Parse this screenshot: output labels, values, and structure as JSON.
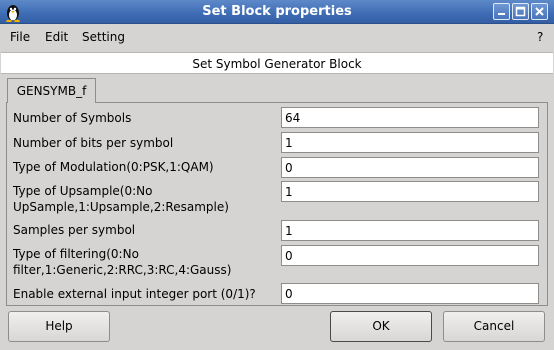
{
  "window": {
    "title": "Set Block properties",
    "icon": "penguin-app-icon",
    "buttons": [
      "minimize-icon",
      "maximize-icon",
      "close-icon"
    ]
  },
  "menu": {
    "file": "File",
    "edit": "Edit",
    "setting": "Setting",
    "help": "?"
  },
  "header": "Set Symbol Generator Block",
  "tab": {
    "label": "GENSYMB_f"
  },
  "fields": [
    {
      "label": "Number of Symbols",
      "value": "64"
    },
    {
      "label": "Number of bits per symbol",
      "value": "1"
    },
    {
      "label": "Type of Modulation(0:PSK,1:QAM)",
      "value": "0"
    },
    {
      "label_line1": "Type of Upsample(0:No",
      "label_line2": "UpSample,1:Upsample,2:Resample)",
      "value": "1"
    },
    {
      "label": "Samples per symbol",
      "value": "1"
    },
    {
      "label_line1": "Type of filtering(0:No",
      "label_line2": "filter,1:Generic,2:RRC,3:RC,4:Gauss)",
      "value": "0"
    },
    {
      "label": "Enable external input integer port (0/1)?",
      "value": "0"
    }
  ],
  "buttons": {
    "help": "Help",
    "ok": "OK",
    "cancel": "Cancel"
  }
}
